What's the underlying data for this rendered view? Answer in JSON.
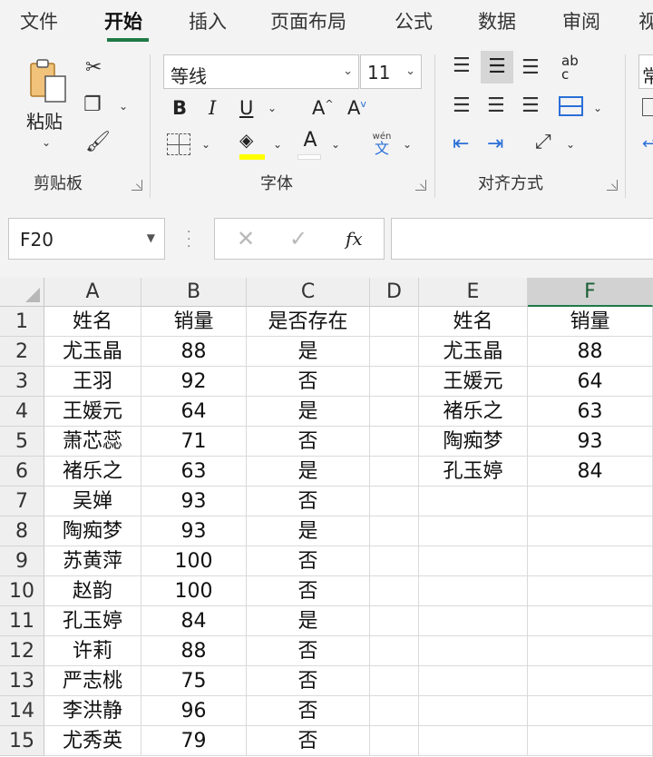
{
  "tabs": [
    "文件",
    "开始",
    "插入",
    "页面布局",
    "公式",
    "数据",
    "审阅",
    "视"
  ],
  "active_tab": "开始",
  "ribbon": {
    "clipboard": {
      "label": "剪贴板",
      "paste_label": "粘贴"
    },
    "font": {
      "label": "字体",
      "font_name": "等线",
      "font_size": "11",
      "bold": "B",
      "italic": "I",
      "underline": "U",
      "grow": "A",
      "shrink": "A",
      "font_color": "A",
      "phonetic_top": "wén",
      "phonetic_bottom": "文"
    },
    "alignment": {
      "label": "对齐方式",
      "wrap_text": "ab c"
    },
    "number": {
      "format_peek": "常"
    }
  },
  "formula_bar": {
    "name_box": "F20",
    "fx": "fx",
    "formula": ""
  },
  "sheet": {
    "columns": [
      "A",
      "B",
      "C",
      "D",
      "E",
      "F"
    ],
    "selected_column": "F",
    "rows": [
      [
        "姓名",
        "销量",
        "是否存在",
        "",
        "姓名",
        "销量"
      ],
      [
        "尤玉晶",
        "88",
        "是",
        "",
        "尤玉晶",
        "88"
      ],
      [
        "王羽",
        "92",
        "否",
        "",
        "王媛元",
        "64"
      ],
      [
        "王媛元",
        "64",
        "是",
        "",
        "褚乐之",
        "63"
      ],
      [
        "萧芯蕊",
        "71",
        "否",
        "",
        "陶痴梦",
        "93"
      ],
      [
        "褚乐之",
        "63",
        "是",
        "",
        "孔玉婷",
        "84"
      ],
      [
        "吴婵",
        "93",
        "否",
        "",
        "",
        ""
      ],
      [
        "陶痴梦",
        "93",
        "是",
        "",
        "",
        ""
      ],
      [
        "苏黄萍",
        "100",
        "否",
        "",
        "",
        ""
      ],
      [
        "赵韵",
        "100",
        "否",
        "",
        "",
        ""
      ],
      [
        "孔玉婷",
        "84",
        "是",
        "",
        "",
        ""
      ],
      [
        "许莉",
        "88",
        "否",
        "",
        "",
        ""
      ],
      [
        "严志桃",
        "75",
        "否",
        "",
        "",
        ""
      ],
      [
        "李洪静",
        "96",
        "否",
        "",
        "",
        ""
      ],
      [
        "尤秀英",
        "79",
        "否",
        "",
        "",
        ""
      ]
    ]
  },
  "colors": {
    "accent": "#1f7a45",
    "highlight_yellow": "#ffff00",
    "ribbon_bg": "#f3f3f3"
  }
}
